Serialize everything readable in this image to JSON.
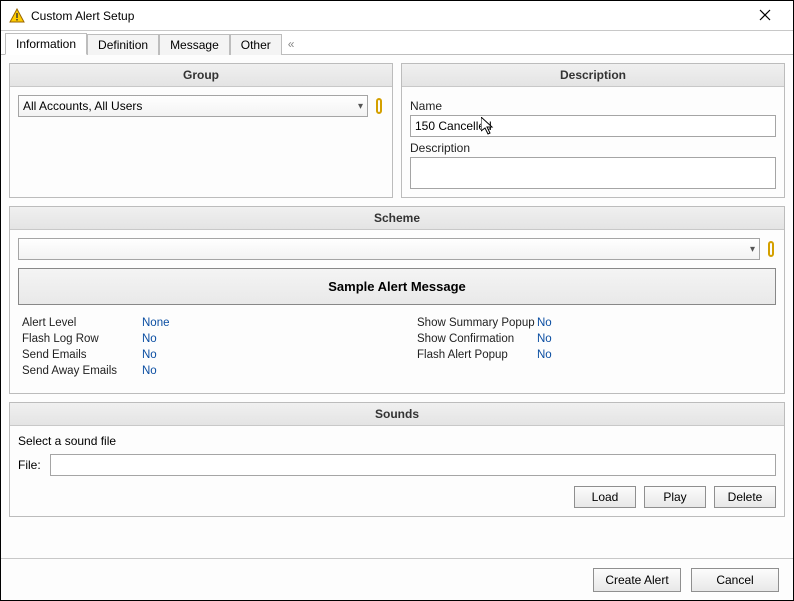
{
  "window": {
    "title": "Custom Alert Setup"
  },
  "tabs": {
    "information": "Information",
    "definition": "Definition",
    "message": "Message",
    "other": "Other"
  },
  "group": {
    "header": "Group",
    "selected": "All Accounts, All Users"
  },
  "description": {
    "header": "Description",
    "name_label": "Name",
    "name_value": "150 Cancelled",
    "desc_label": "Description",
    "desc_value": ""
  },
  "scheme": {
    "header": "Scheme",
    "selected": "",
    "sample": "Sample Alert Message",
    "left": [
      {
        "label": "Alert Level",
        "value": "None"
      },
      {
        "label": "Flash Log Row",
        "value": "No"
      },
      {
        "label": "Send Emails",
        "value": "No"
      },
      {
        "label": "Send Away Emails",
        "value": "No"
      }
    ],
    "right": [
      {
        "label": "Show Summary Popup",
        "value": "No"
      },
      {
        "label": "Show Confirmation",
        "value": "No"
      },
      {
        "label": "Flash Alert Popup",
        "value": "No"
      }
    ]
  },
  "sounds": {
    "header": "Sounds",
    "instruction": "Select a sound file",
    "file_label": "File:",
    "file_value": "",
    "load": "Load",
    "play": "Play",
    "delete": "Delete"
  },
  "footer": {
    "create": "Create Alert",
    "cancel": "Cancel"
  }
}
